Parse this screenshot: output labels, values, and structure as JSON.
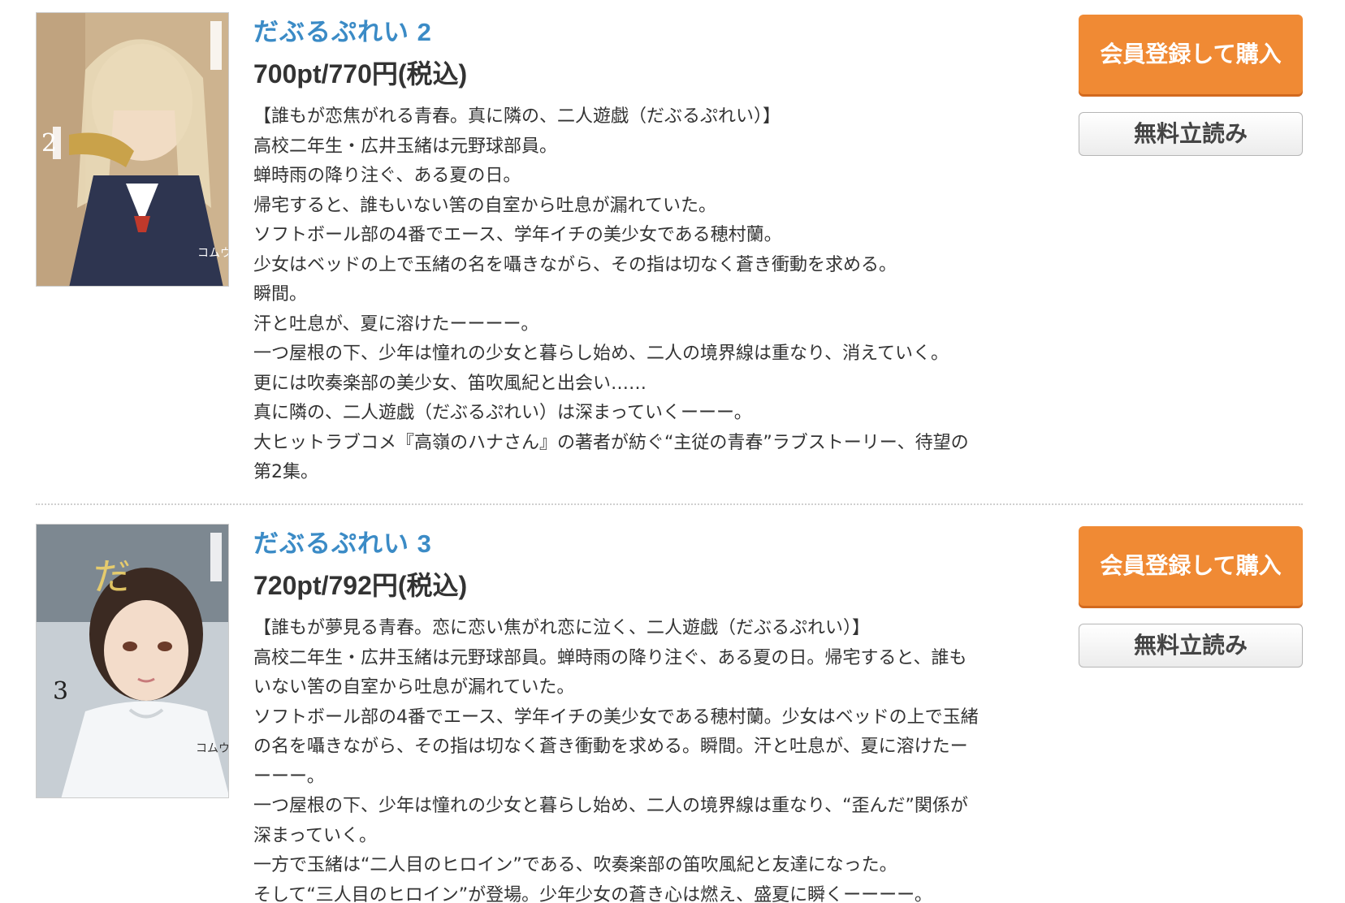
{
  "items": [
    {
      "title": "だぶるぷれい 2",
      "price": "700pt/770円(税込)",
      "buy_label": "会員登録して購入",
      "read_label": "無料立読み",
      "description": [
        "【誰もが恋焦がれる青春。真に隣の、二人遊戯（だぶるぷれい）】",
        "高校二年生・広井玉緒は元野球部員。",
        "蝉時雨の降り注ぐ、ある夏の日。",
        "帰宅すると、誰もいない筈の自室から吐息が漏れていた。",
        "ソフトボール部の4番でエース、学年イチの美少女である穂村蘭。",
        "少女はベッドの上で玉緒の名を囁きながら、その指は切なく蒼き衝動を求める。",
        "瞬間。",
        "汗と吐息が、夏に溶けたーーーー。",
        "一つ屋根の下、少年は憧れの少女と暮らし始め、二人の境界線は重なり、消えていく。",
        "更には吹奏楽部の美少女、笛吹風紀と出会い……",
        "真に隣の、二人遊戯（だぶるぷれい）は深まっていくーーー。",
        "大ヒットラブコメ『高嶺のハナさん』の著者が紡ぐ“主従の青春”ラブストーリー、待望の",
        "第2集。"
      ]
    },
    {
      "title": "だぶるぷれい 3",
      "price": "720pt/792円(税込)",
      "buy_label": "会員登録して購入",
      "read_label": "無料立読み",
      "description": [
        "【誰もが夢見る青春。恋に恋い焦がれ恋に泣く、二人遊戯（だぶるぷれい）】",
        "高校二年生・広井玉緒は元野球部員。蝉時雨の降り注ぐ、ある夏の日。帰宅すると、誰も",
        "いない筈の自室から吐息が漏れていた。",
        "ソフトボール部の4番でエース、学年イチの美少女である穂村蘭。少女はベッドの上で玉緒",
        "の名を囁きながら、その指は切なく蒼き衝動を求める。瞬間。汗と吐息が、夏に溶けたー",
        "ーーー。",
        "一つ屋根の下、少年は憧れの少女と暮らし始め、二人の境界線は重なり、“歪んだ”関係が",
        "深まっていく。",
        "一方で玉緒は“二人目のヒロイン”である、吹奏楽部の笛吹風紀と友達になった。",
        "そして“三人目のヒロイン”が登場。少年少女の蒼き心は燃え、盛夏に瞬くーーーー。"
      ]
    }
  ],
  "colors": {
    "title_link": "#3b8bc6",
    "buy_button": "#f08a34",
    "read_button_border": "#b5b5b5"
  }
}
